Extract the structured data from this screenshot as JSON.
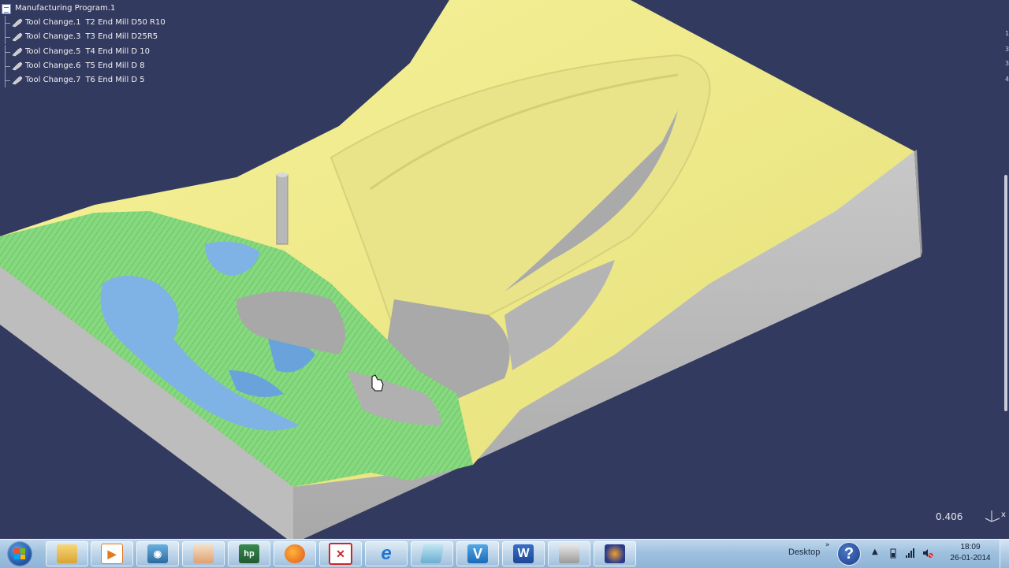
{
  "tree": {
    "root": "Manufacturing Program.1",
    "items": [
      {
        "name": "Tool Change.1",
        "tool": "T2 End Mill D50 R10"
      },
      {
        "name": "Tool Change.3",
        "tool": "T3 End Mill D25R5"
      },
      {
        "name": "Tool Change.5",
        "tool": "T4 End Mill D 10"
      },
      {
        "name": "Tool Change.6",
        "tool": "T5 End Mill D 8"
      },
      {
        "name": "Tool Change.7",
        "tool": "T6 End Mill D 5"
      }
    ]
  },
  "viewport": {
    "background_color": "#333a5f",
    "scale_readout": "0.406",
    "compass_label": "x",
    "right_edge_marks": [
      "1",
      "3",
      "3",
      "4"
    ],
    "material_colors": {
      "stock": "#f2ed8e",
      "finished": "#86d97e",
      "roughed": "#7fb3e6",
      "walls": "#bfbfbf"
    }
  },
  "taskbar": {
    "desktop_label": "Desktop",
    "chevrons": "»",
    "help_label": "?",
    "tray_expand": "▲",
    "time": "18:09",
    "date": "26-01-2014",
    "apps": [
      {
        "name": "explorer",
        "glyph": ""
      },
      {
        "name": "media-player",
        "glyph": ""
      },
      {
        "name": "camera",
        "glyph": ""
      },
      {
        "name": "paint",
        "glyph": ""
      },
      {
        "name": "hp",
        "glyph": "hp"
      },
      {
        "name": "firefox",
        "glyph": ""
      },
      {
        "name": "pdf",
        "glyph": ""
      },
      {
        "name": "internet-explorer",
        "glyph": "e"
      },
      {
        "name": "notes",
        "glyph": ""
      },
      {
        "name": "catia",
        "glyph": "V"
      },
      {
        "name": "word",
        "glyph": "W"
      },
      {
        "name": "folder",
        "glyph": ""
      },
      {
        "name": "photo-viewer",
        "glyph": ""
      }
    ]
  }
}
